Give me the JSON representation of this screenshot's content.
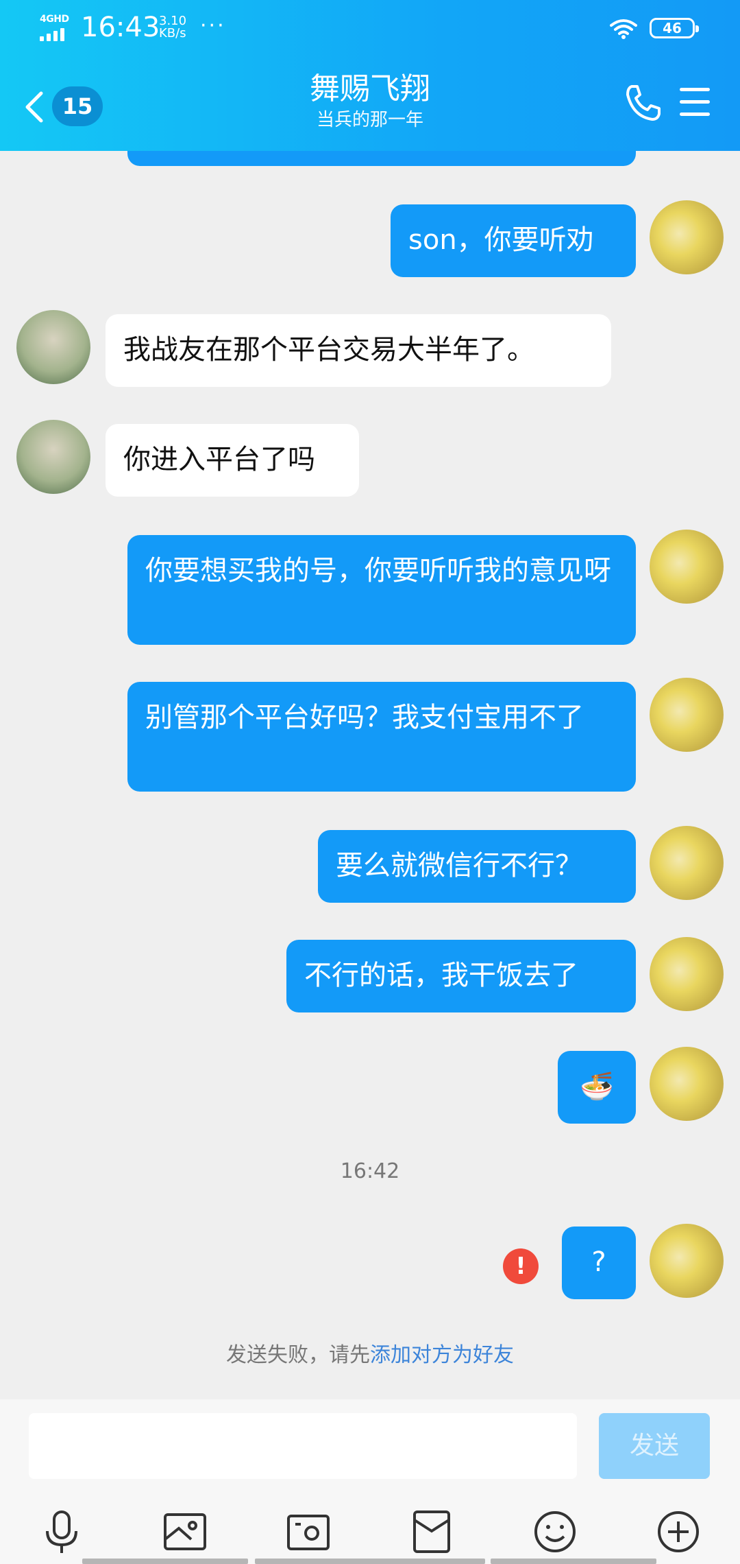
{
  "status": {
    "network": "4GHD",
    "time": "16:43",
    "speed_value": "3.10",
    "speed_unit": "KB/s",
    "dots": "···",
    "battery": "46"
  },
  "header": {
    "badge_count": "15",
    "title": "舞赐飞翔",
    "subtitle": "当兵的那一年"
  },
  "messages": [
    {
      "text": "son，你要听劝"
    },
    {
      "text": "我战友在那个平台交易大半年了。"
    },
    {
      "text": "你进入平台了吗"
    },
    {
      "text": "你要想买我的号，你要听听我的意见呀"
    },
    {
      "text": "别管那个平台好吗？我支付宝用不了"
    },
    {
      "text": "要么就微信行不行？"
    },
    {
      "text": "不行的话，我干饭去了"
    },
    {
      "text": "🍜"
    },
    {
      "text": "?"
    }
  ],
  "timestamp": "16:42",
  "fail_note": {
    "prefix": "发送失败，请先",
    "link": "添加对方为好友"
  },
  "input": {
    "placeholder": "",
    "send_label": "发送"
  },
  "colors": {
    "accent": "#139af8",
    "header_start": "#14c8f5",
    "error": "#f04a3b",
    "link": "#3c84d9"
  },
  "icons": [
    "back-arrow-icon",
    "phone-icon",
    "menu-icon",
    "microphone-icon",
    "image-icon",
    "camera-icon",
    "red-packet-icon",
    "emoji-icon",
    "plus-icon",
    "error-icon"
  ]
}
